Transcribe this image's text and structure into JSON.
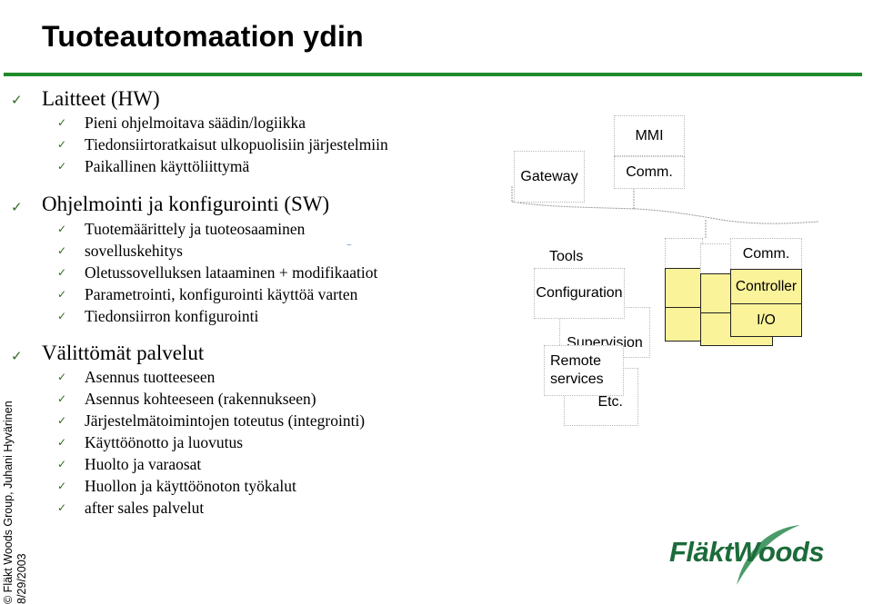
{
  "slide": {
    "title": "Tuoteautomaation ydin",
    "accent_color": "#1f8a2a",
    "check_icon": "✓",
    "footer_vertical": {
      "copyright": "© Fläkt Woods Group, Juhani Hyvärinen",
      "date": "8/29/2003"
    },
    "logo_text": "FläktWoods"
  },
  "sections": [
    {
      "heading": "Laitteet (HW)",
      "items": [
        "Pieni ohjelmoitava säädin/logiikka",
        "Tiedonsiirtoratkaisut ulkopuolisiin järjestelmiin",
        "Paikallinen käyttöliittymä"
      ]
    },
    {
      "heading": "Ohjelmointi ja konfigurointi (SW)",
      "items": [
        "Tuotemäärittely ja tuoteosaaminen",
        "sovelluskehitys",
        "Oletussovelluksen lataaminen + modifikaatiot",
        "Parametrointi, konfigurointi käyttöä varten",
        "Tiedonsiirron konfigurointi"
      ]
    },
    {
      "heading": "Välittömät palvelut",
      "items": [
        "Asennus tuotteeseen",
        "Asennus kohteeseen (rakennukseen)",
        "Järjestelmätoimintojen toteutus (integrointi)",
        "Käyttöönotto ja luovutus",
        "Huolto ja varaosat",
        "Huollon ja käyttöönoton työkalut",
        "after sales palvelut"
      ]
    }
  ],
  "diagram": {
    "gateway": "Gateway",
    "mmi": "MMI",
    "mmi_comm": "Comm.",
    "tools_label": "Tools",
    "tools": [
      "Configuration",
      "Supervision",
      "Remote services",
      "Etc."
    ],
    "remote_line1": "Remote",
    "remote_line2": "services",
    "device_comm": "Comm.",
    "device_controller": "Controller",
    "device_io": "I/O",
    "controller_fill": "#fbf39a"
  }
}
